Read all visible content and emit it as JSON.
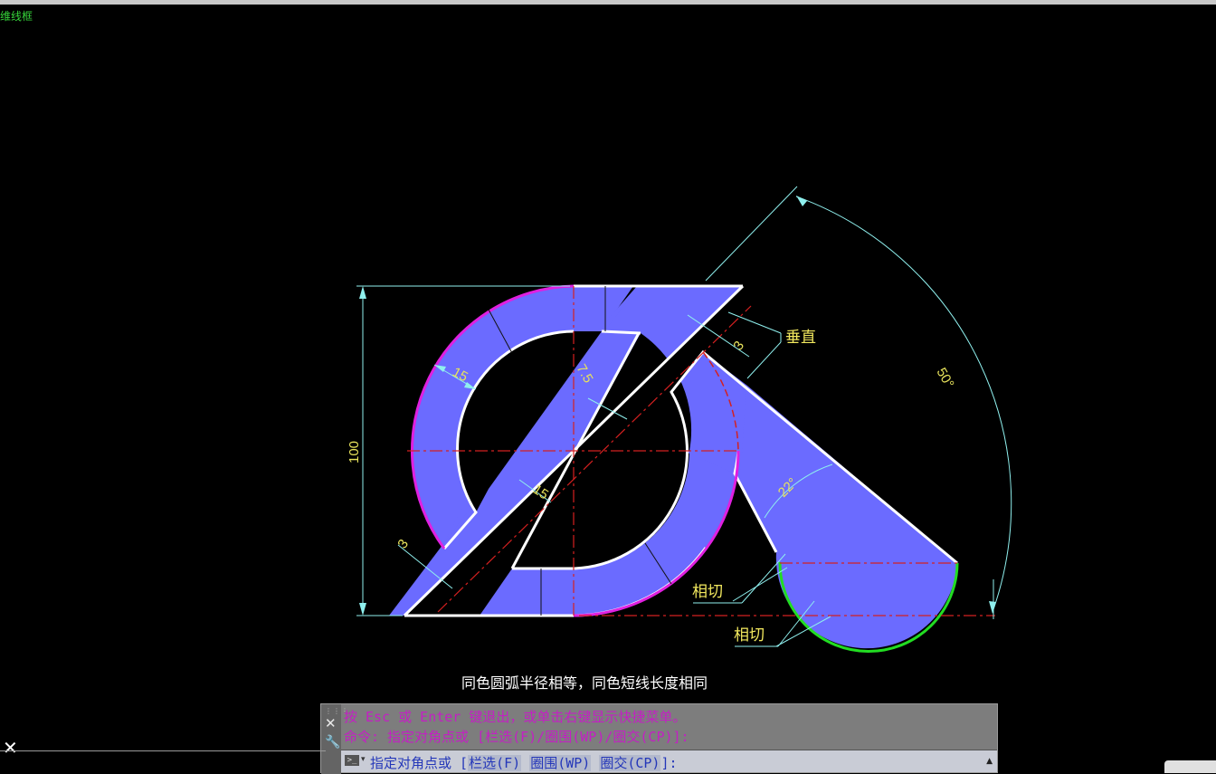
{
  "viewport": {
    "view_label": "维线框",
    "note": "同色圆弧半径相等，同色短线长度相同"
  },
  "dimensions": {
    "height": "100",
    "ring_width": "15",
    "bar_width": "15",
    "offset": "7.5",
    "gap_top": "3",
    "gap_bottom": "3",
    "arc_angle": "50°",
    "wedge_angle": "22°"
  },
  "annotations": {
    "perpendicular": "垂直",
    "tangent_1": "相切",
    "tangent_2": "相切"
  },
  "colors": {
    "fill": "#6b6bff",
    "outline": "#ffffff",
    "magenta_arc": "#e020e0",
    "green_arc": "#22dd22",
    "dimension": "#8ff0ee",
    "centerline": "#d42020",
    "dim_text": "#e8e35c"
  },
  "command_line": {
    "history_1": "按 Esc 或 Enter 键退出，或单击右键显示快捷菜单。",
    "history_2": "命令: 指定对角点或 [栏选(F)/圈围(WP)/圈交(CP)]:",
    "prompt_prefix": "指定对角点或 [",
    "option_1": "栏选(F)",
    "option_2": "圈围(WP)",
    "option_3": "圈交(CP)",
    "prompt_suffix": "]:",
    "prompt_icon": ">_"
  },
  "icons": [
    "close-icon",
    "wrench-icon",
    "terminal-icon",
    "scroll-arrow-icon"
  ]
}
